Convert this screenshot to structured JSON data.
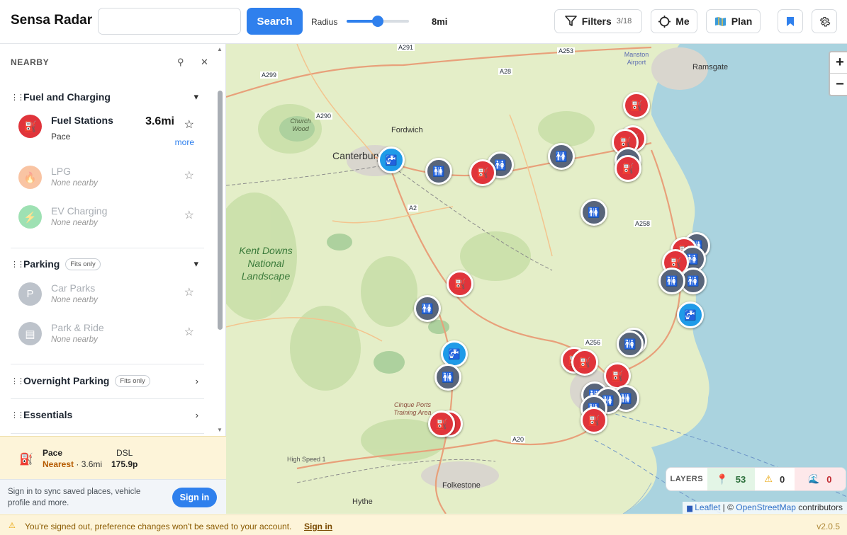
{
  "header": {
    "brand": "Sensa Radar",
    "search_placeholder": "",
    "search_button": "Search",
    "radius_label": "Radius",
    "radius_value": "8mi",
    "radius_fraction": 0.5,
    "filters_label": "Filters",
    "filters_count": "3/18",
    "me_label": "Me",
    "plan_label": "Plan"
  },
  "sidebar": {
    "title": "NEARBY",
    "categories": [
      {
        "title": "Fuel and Charging",
        "fits": "",
        "items": [
          {
            "name": "Fuel Stations",
            "sub": "Pace",
            "dist": "3.6mi",
            "more": "more"
          },
          {
            "name": "LPG",
            "sub": "None nearby"
          },
          {
            "name": "EV Charging",
            "sub": "None nearby"
          }
        ]
      },
      {
        "title": "Parking",
        "fits": "Fits only",
        "items": [
          {
            "name": "Car Parks",
            "sub": "None nearby"
          },
          {
            "name": "Park & Ride",
            "sub": "None nearby"
          }
        ]
      },
      {
        "title": "Overnight Parking",
        "fits": "Fits only"
      },
      {
        "title": "Essentials",
        "fits": ""
      }
    ]
  },
  "nearest": {
    "brand": "Pace",
    "label": "Nearest",
    "distance": "· 3.6mi",
    "fuel_type": "DSL",
    "price": "175.9p"
  },
  "signin": {
    "text": "Sign in to sync saved places, vehicle profile and more.",
    "button": "Sign in"
  },
  "banner": {
    "message": "You're signed out, preference changes won't be saved to your account.",
    "link": "Sign in",
    "version": "v2.0.5"
  },
  "map": {
    "labels": {
      "canterbury": "Canterbury",
      "fordwich": "Fordwich",
      "church_wood": "Church Wood",
      "kent_downs": "Kent Downs National Landscape",
      "ramsgate": "Ramsgate",
      "manston": "Manston Airport",
      "folkestone": "Folkestone",
      "hythe": "Hythe",
      "cinque": "Cinque Ports Training Area",
      "high_speed": "High Speed 1",
      "a291": "A291",
      "a253": "A253",
      "a299": "A299",
      "a28": "A28",
      "a290": "A290",
      "a2": "A2",
      "a258": "A258",
      "a256": "A256",
      "a20": "A20"
    },
    "layers": {
      "label": "LAYERS",
      "places": "53",
      "warnings": "0",
      "water": "0"
    },
    "attribution": {
      "leaflet": "Leaflet",
      "sep": " | © ",
      "osm": "OpenStreetMap",
      "suffix": " contributors"
    },
    "zoom_in": "+",
    "zoom_out": "−"
  },
  "colors": {
    "accent": "#2f80ed",
    "fuel": "#e0343b",
    "toilet": "#59657a",
    "water": "#1f9be8"
  }
}
